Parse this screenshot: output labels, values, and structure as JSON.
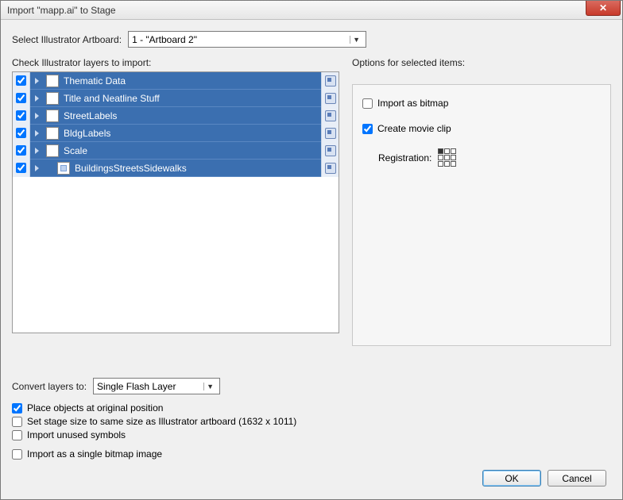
{
  "window": {
    "title": "Import \"mapp.ai\" to Stage"
  },
  "artboard": {
    "label": "Select Illustrator Artboard:",
    "value": "1 - \"Artboard 2\""
  },
  "layers": {
    "label": "Check Illustrator layers to import:",
    "items": [
      {
        "name": "Thematic Data",
        "checked": true,
        "indent": 0
      },
      {
        "name": "Title and Neatline Stuff",
        "checked": true,
        "indent": 0
      },
      {
        "name": "StreetLabels",
        "checked": true,
        "indent": 0
      },
      {
        "name": "BldgLabels",
        "checked": true,
        "indent": 0
      },
      {
        "name": "Scale",
        "checked": true,
        "indent": 0
      },
      {
        "name": "BuildingsStreetsSidewalks",
        "checked": true,
        "indent": 1
      }
    ]
  },
  "options": {
    "heading": "Options for selected items:",
    "bitmap": {
      "label": "Import as bitmap",
      "checked": false
    },
    "movieclip": {
      "label": "Create movie clip",
      "checked": true
    },
    "registration_label": "Registration:"
  },
  "convert": {
    "label": "Convert layers to:",
    "value": "Single Flash Layer"
  },
  "checkboxes": {
    "place_original": {
      "label": "Place objects at original position",
      "checked": true
    },
    "stage_size": {
      "label": "Set stage size to same size as Illustrator artboard (1632 x 1011)",
      "checked": false
    },
    "unused_symbols": {
      "label": "Import unused symbols",
      "checked": false
    },
    "single_bitmap": {
      "label": "Import as a single bitmap image",
      "checked": false
    }
  },
  "buttons": {
    "ok": "OK",
    "cancel": "Cancel"
  }
}
